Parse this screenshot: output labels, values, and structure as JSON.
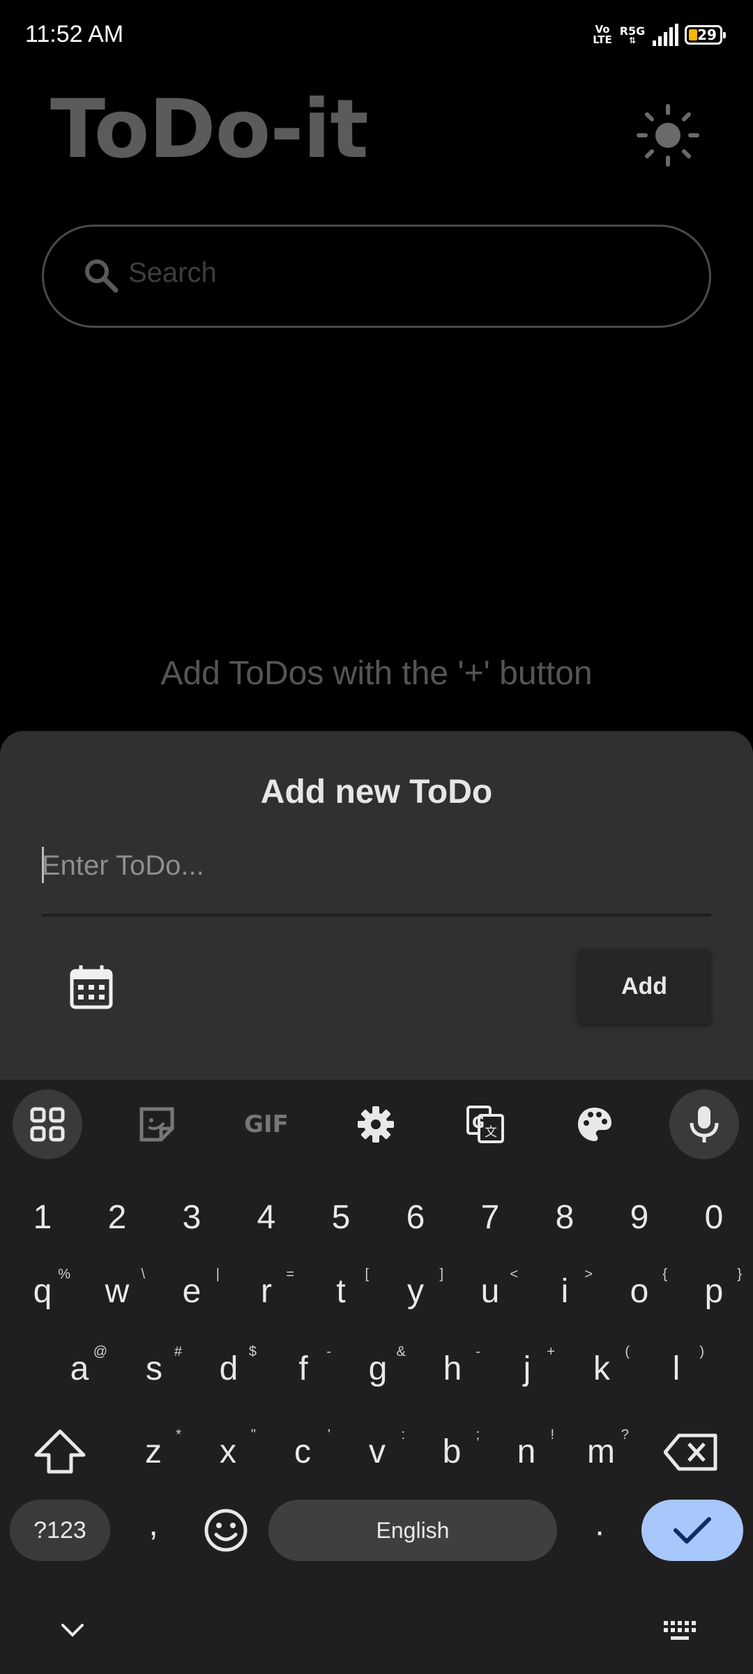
{
  "status_bar": {
    "time": "11:52 AM",
    "volte_top": "Vo",
    "volte_bottom": "LTE",
    "network": "R5G",
    "battery": "29"
  },
  "app": {
    "title": "ToDo-it",
    "search_placeholder": "Search",
    "empty_hint": "Add ToDos with the '+' button"
  },
  "sheet": {
    "title": "Add new ToDo",
    "input_placeholder": "Enter ToDo...",
    "add_label": "Add"
  },
  "keyboard": {
    "toolbar": [
      "apps-grid-icon",
      "sticker-icon",
      "gif-icon",
      "settings-icon",
      "translate-icon",
      "palette-icon",
      "mic-icon"
    ],
    "gif_label": "GIF",
    "numbers": [
      "1",
      "2",
      "3",
      "4",
      "5",
      "6",
      "7",
      "8",
      "9",
      "0"
    ],
    "row1": [
      {
        "k": "q",
        "s": "%"
      },
      {
        "k": "w",
        "s": "\\"
      },
      {
        "k": "e",
        "s": "|"
      },
      {
        "k": "r",
        "s": "="
      },
      {
        "k": "t",
        "s": "["
      },
      {
        "k": "y",
        "s": "]"
      },
      {
        "k": "u",
        "s": "<"
      },
      {
        "k": "i",
        "s": ">"
      },
      {
        "k": "o",
        "s": "{"
      },
      {
        "k": "p",
        "s": "}"
      }
    ],
    "row2": [
      {
        "k": "a",
        "s": "@"
      },
      {
        "k": "s",
        "s": "#"
      },
      {
        "k": "d",
        "s": "$"
      },
      {
        "k": "f",
        "s": "-"
      },
      {
        "k": "g",
        "s": "&"
      },
      {
        "k": "h",
        "s": "-"
      },
      {
        "k": "j",
        "s": "+"
      },
      {
        "k": "k",
        "s": "("
      },
      {
        "k": "l",
        "s": ")"
      }
    ],
    "row3": [
      {
        "k": "z",
        "s": "*"
      },
      {
        "k": "x",
        "s": "\""
      },
      {
        "k": "c",
        "s": "'"
      },
      {
        "k": "v",
        "s": ":"
      },
      {
        "k": "b",
        "s": ";"
      },
      {
        "k": "n",
        "s": "!"
      },
      {
        "k": "m",
        "s": "?"
      }
    ],
    "symbols_label": "?123",
    "comma": ",",
    "space_label": "English",
    "period": ".",
    "accent_color": "#a8c7fa"
  }
}
